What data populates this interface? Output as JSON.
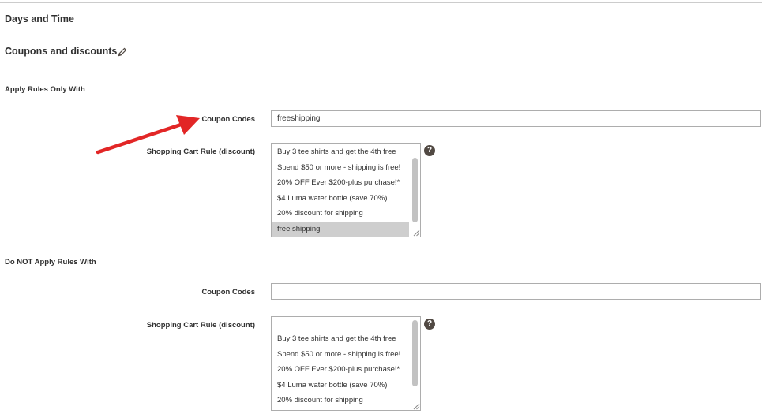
{
  "sections": {
    "days_and_time": "Days and Time",
    "coupons_and_discounts": "Coupons and discounts"
  },
  "apply_rules": {
    "title": "Apply Rules Only With",
    "coupon_label": "Coupon Codes",
    "coupon_value": "freeshipping",
    "cart_rule_label": "Shopping Cart Rule (discount)",
    "cart_rule_options": [
      "Buy 3 tee shirts and get the 4th free",
      "Spend $50 or more - shipping is free!",
      "20% OFF Ever $200-plus purchase!*",
      "$4 Luma water bottle (save 70%)",
      "20% discount for shipping",
      "free shipping"
    ],
    "selected_option": "free shipping"
  },
  "not_apply_rules": {
    "title": "Do NOT Apply Rules With",
    "coupon_label": "Coupon Codes",
    "coupon_value": "",
    "cart_rule_label": "Shopping Cart Rule (discount)",
    "cart_rule_options": [
      "Buy 3 tee shirts and get the 4th free",
      "Spend $50 or more - shipping is free!",
      "20% OFF Ever $200-plus purchase!*",
      "$4 Luma water bottle (save 70%)",
      "20% discount for shipping"
    ]
  },
  "help_icon_glyph": "?",
  "icons": {
    "edit": "pencil-icon",
    "help": "question-mark-icon",
    "annotation": "red-arrow"
  },
  "colors": {
    "text": "#303030",
    "border": "#adadad",
    "selected_bg": "#cecece",
    "help_bg": "#514943",
    "arrow": "#e22626"
  }
}
